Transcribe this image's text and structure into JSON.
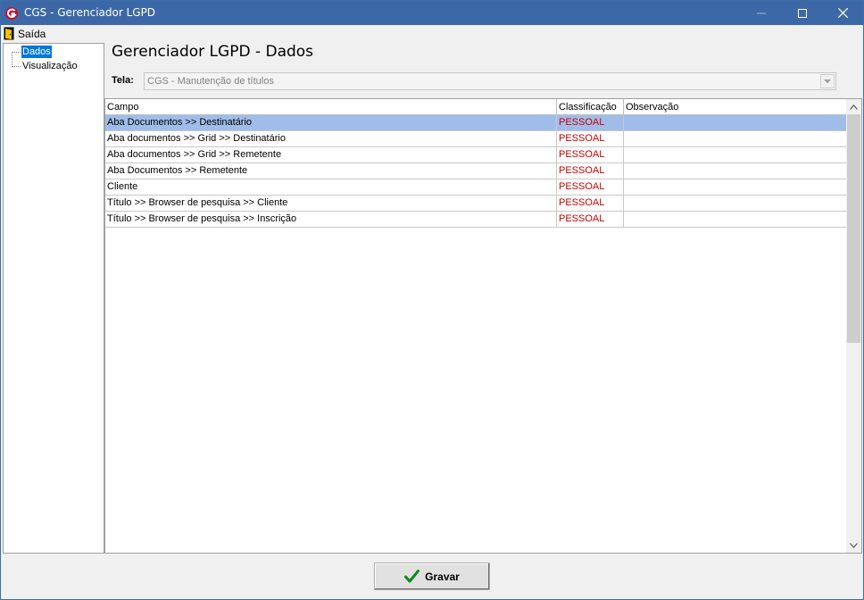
{
  "window": {
    "title": "CGS - Gerenciador LGPD",
    "minimize_icon": "minimize-icon",
    "maximize_icon": "maximize-icon",
    "close_icon": "close-icon"
  },
  "menu": {
    "items": [
      {
        "label": "Saída",
        "icon": "exit-door-icon"
      }
    ]
  },
  "tree": {
    "items": [
      {
        "label": "Dados",
        "selected": true
      },
      {
        "label": "Visualização",
        "selected": false
      }
    ]
  },
  "page": {
    "heading": "Gerenciador LGPD - Dados",
    "tela_label": "Tela:",
    "tela_value": "CGS - Manutenção de títulos"
  },
  "grid": {
    "columns": [
      "Campo",
      "Classificação",
      "Observação"
    ],
    "rows": [
      {
        "campo": "Aba Documentos >> Destinatário",
        "classificacao": "PESSOAL",
        "observacao": "",
        "selected": true
      },
      {
        "campo": "Aba documentos >> Grid  >> Destinatário",
        "classificacao": "PESSOAL",
        "observacao": ""
      },
      {
        "campo": "Aba documentos >> Grid  >> Remetente",
        "classificacao": "PESSOAL",
        "observacao": ""
      },
      {
        "campo": "Aba Documentos >> Remetente",
        "classificacao": "PESSOAL",
        "observacao": ""
      },
      {
        "campo": "Cliente",
        "classificacao": "PESSOAL",
        "observacao": ""
      },
      {
        "campo": "Título >> Browser de pesquisa >> Cliente",
        "classificacao": "PESSOAL",
        "observacao": ""
      },
      {
        "campo": "Título >> Browser de pesquisa >> Inscrição",
        "classificacao": "PESSOAL",
        "observacao": ""
      }
    ]
  },
  "footer": {
    "save_label": "Gravar",
    "save_icon": "checkmark-icon"
  },
  "colors": {
    "titlebar": "#3d68a8",
    "selection": "#0078d7",
    "row_selected": "#9fbde8",
    "classification_text": "#cc0000"
  }
}
